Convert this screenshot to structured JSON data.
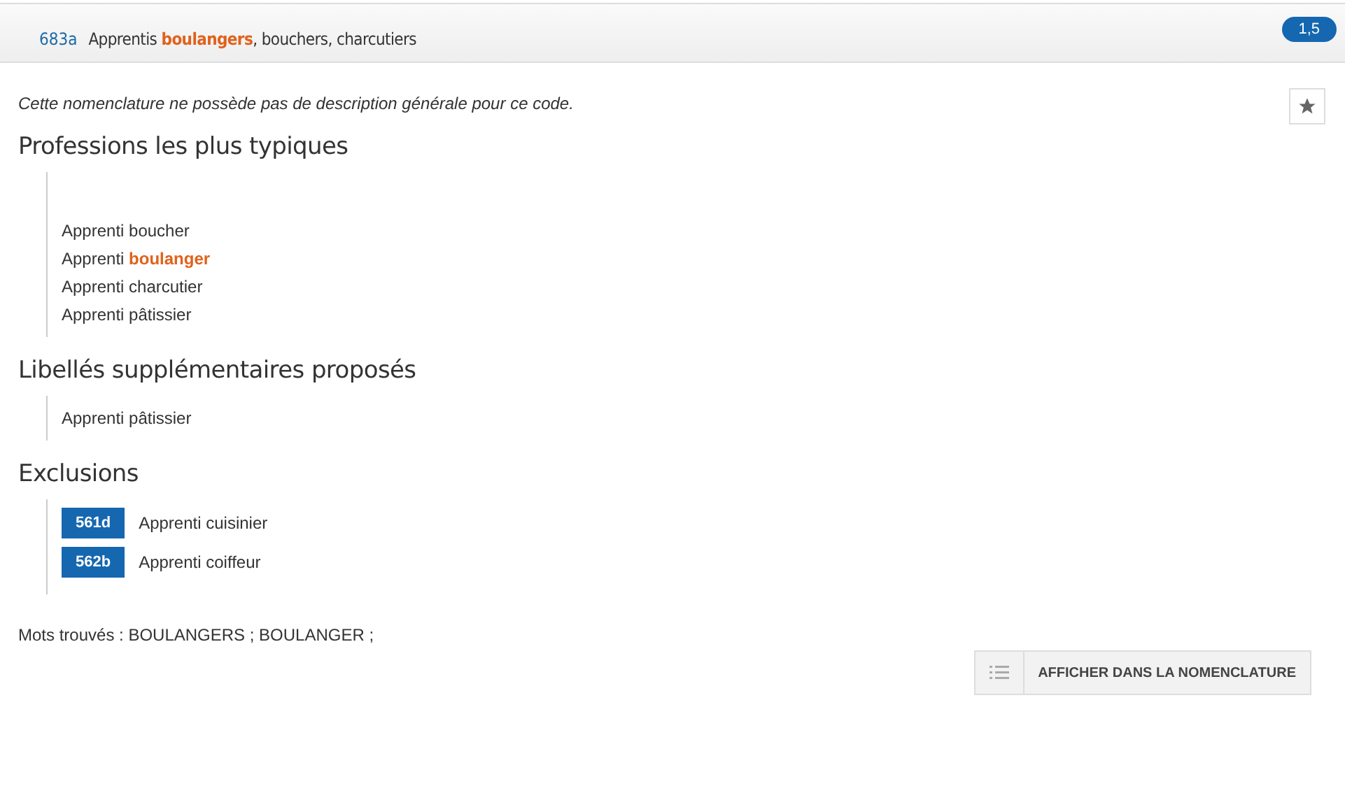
{
  "header": {
    "code": "683a",
    "title": "Apprentis **boulangers**, bouchers, charcutiers",
    "badge": "1,5"
  },
  "description": "Cette nomenclature ne possède pas de description générale pour ce code.",
  "sections": [
    {
      "title": "Professions les plus typiques",
      "kind": "list",
      "items": [
        {
          "text": "Apprenti boucher"
        },
        {
          "text": "Apprenti **boulanger**"
        },
        {
          "text": "Apprenti charcutier"
        },
        {
          "text": "Apprenti pâtissier"
        }
      ]
    },
    {
      "title": "Libellés supplémentaires proposés",
      "kind": "list",
      "items": [
        {
          "text": "Apprenti pâtissier"
        }
      ]
    },
    {
      "title": "Exclusions",
      "kind": "codes",
      "items": [
        {
          "code": "561d",
          "text": "Apprenti cuisinier"
        },
        {
          "code": "562b",
          "text": "Apprenti coiffeur"
        }
      ]
    }
  ],
  "found_words": "Mots trouvés : BOULANGERS ; BOULANGER ;",
  "action_button": "AFFICHER DANS LA NOMENCLATURE"
}
